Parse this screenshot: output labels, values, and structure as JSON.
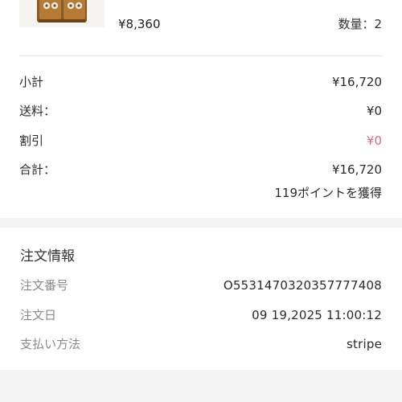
{
  "product": {
    "price": "¥8,360",
    "quantity_label": "数量：",
    "quantity_value": "2"
  },
  "summary": {
    "subtotal_label": "小計",
    "subtotal_value": "¥16,720",
    "shipping_label": "送料：",
    "shipping_value": "¥0",
    "discount_label": "割引",
    "discount_value": "¥0",
    "total_label": "合計：",
    "total_value": "¥16,720",
    "points_text": "119ポイントを獲得"
  },
  "order_info": {
    "title": "注文情報",
    "order_number_label": "注文番号",
    "order_number_value": "O5531470320357777408",
    "order_date_label": "注文日",
    "order_date_value": "09 19,2025 11:00:12",
    "payment_method_label": "支払い方法",
    "payment_method_value": "stripe"
  },
  "colors": {
    "discount": "#d86a7d",
    "muted_label": "#8a8a8a",
    "page_background": "#f4f4f5"
  }
}
